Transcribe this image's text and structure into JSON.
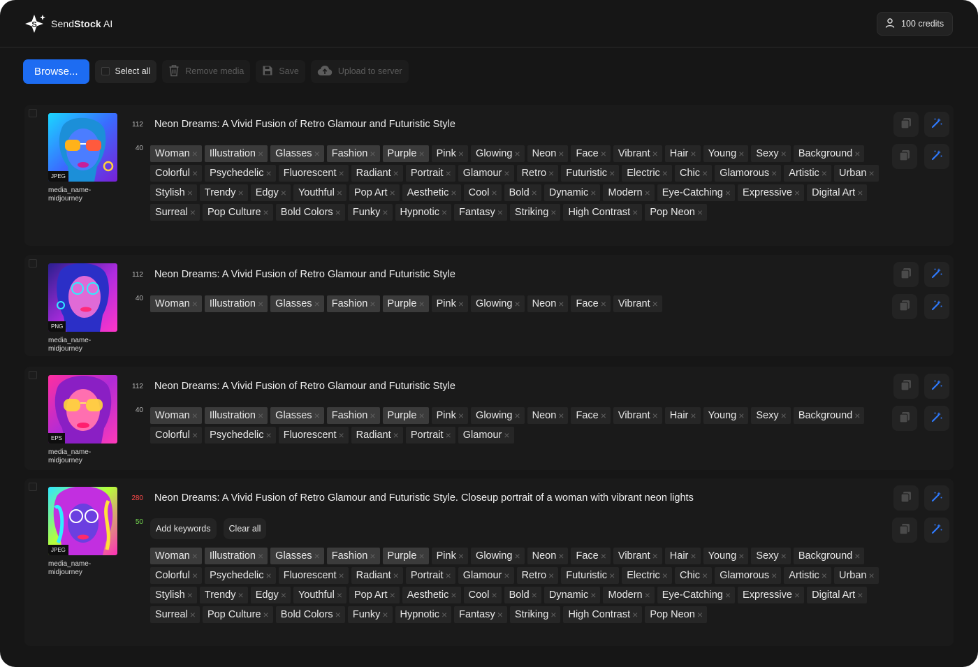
{
  "app": {
    "brand_light": "Send",
    "brand_bold": "Stock",
    "brand_suffix": " AI",
    "credits": "100 credits"
  },
  "toolbar": {
    "browse": "Browse...",
    "select_all": "Select all",
    "remove_media": "Remove media",
    "save": "Save",
    "upload": "Upload to server"
  },
  "colors": {
    "accent": "#1d6cf2",
    "error": "#ff4a4a",
    "ok": "#74d64f"
  },
  "items": [
    {
      "format": "JPEG",
      "filename": "media_name-midjourney",
      "title_count": "112",
      "keyword_count": "40",
      "title": "Neon Dreams: A Vivid Fusion of Retro Glamour and Futuristic Style",
      "keywords": [
        "Woman",
        "Illustration",
        "Glasses",
        "Fashion",
        "Purple",
        "Pink",
        "Glowing",
        "Neon",
        "Face",
        "Vibrant",
        "Hair",
        "Young",
        "Sexy",
        "Background",
        "Colorful",
        "Psychedelic",
        "Fluorescent",
        "Radiant",
        "Portrait",
        "Glamour",
        "Retro",
        "Futuristic",
        "Electric",
        "Chic",
        "Glamorous",
        "Artistic",
        "Urban",
        "Stylish",
        "Trendy",
        "Edgy",
        "Youthful",
        "Pop Art",
        "Aesthetic",
        "Cool",
        "Bold",
        "Dynamic",
        "Modern",
        "Eye-Catching",
        "Expressive",
        "Digital Art",
        "Surreal",
        "Pop Culture",
        "Bold Colors",
        "Funky",
        "Hypnotic",
        "Fantasy",
        "Striking",
        "High Contrast",
        "Pop Neon"
      ]
    },
    {
      "format": "PNG",
      "filename": "media_name-midjourney",
      "title_count": "112",
      "keyword_count": "40",
      "title": "Neon Dreams: A Vivid Fusion of Retro Glamour and Futuristic Style",
      "keywords": [
        "Woman",
        "Illustration",
        "Glasses",
        "Fashion",
        "Purple",
        "Pink",
        "Glowing",
        "Neon",
        "Face",
        "Vibrant"
      ]
    },
    {
      "format": "EPS",
      "filename": "media_name-midjourney",
      "title_count": "112",
      "keyword_count": "40",
      "title": "Neon Dreams: A Vivid Fusion of Retro Glamour and Futuristic Style",
      "keywords": [
        "Woman",
        "Illustration",
        "Glasses",
        "Fashion",
        "Purple",
        "Pink",
        "Glowing",
        "Neon",
        "Face",
        "Vibrant",
        "Hair",
        "Young",
        "Sexy",
        "Background",
        "Colorful",
        "Psychedelic",
        "Fluorescent",
        "Radiant",
        "Portrait",
        "Glamour"
      ]
    },
    {
      "format": "JPEG",
      "filename": "media_name-midjourney",
      "title_count": "280",
      "keyword_count": "50",
      "title": "Neon Dreams: A Vivid Fusion of Retro Glamour and Futuristic Style. Closeup portrait of a woman with vibrant neon lights",
      "add_keywords": "Add keywords",
      "clear_all": "Clear all",
      "keywords": [
        "Woman",
        "Illustration",
        "Glasses",
        "Fashion",
        "Purple",
        "Pink",
        "Glowing",
        "Neon",
        "Face",
        "Vibrant",
        "Hair",
        "Young",
        "Sexy",
        "Background",
        "Colorful",
        "Psychedelic",
        "Fluorescent",
        "Radiant",
        "Portrait",
        "Glamour",
        "Retro",
        "Futuristic",
        "Electric",
        "Chic",
        "Glamorous",
        "Artistic",
        "Urban",
        "Stylish",
        "Trendy",
        "Edgy",
        "Youthful",
        "Pop Art",
        "Aesthetic",
        "Cool",
        "Bold",
        "Dynamic",
        "Modern",
        "Eye-Catching",
        "Expressive",
        "Digital Art",
        "Surreal",
        "Pop Culture",
        "Bold Colors",
        "Funky",
        "Hypnotic",
        "Fantasy",
        "Striking",
        "High Contrast",
        "Pop Neon"
      ]
    }
  ]
}
